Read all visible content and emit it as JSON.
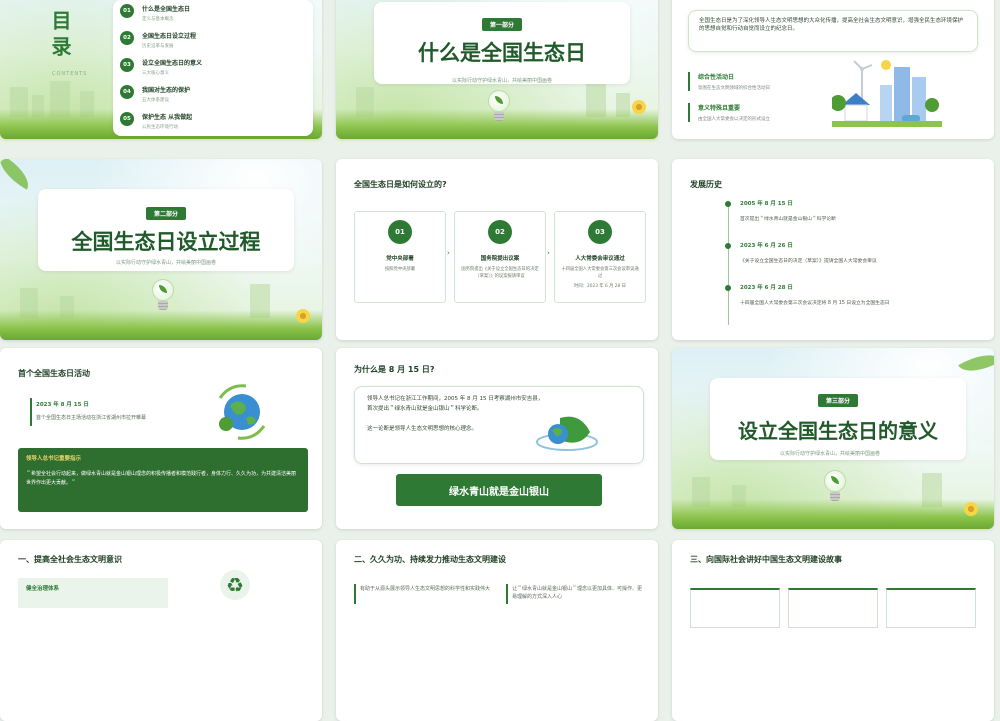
{
  "slides": {
    "toc": {
      "title": "目录",
      "title_en": "CONTENTS",
      "items": [
        {
          "num": "01",
          "title": "什么是全国生态日",
          "sub": "定义与基本概念"
        },
        {
          "num": "02",
          "title": "全国生态日设立过程",
          "sub": "历史沿革与发展"
        },
        {
          "num": "03",
          "title": "设立全国生态日的意义",
          "sub": "三大核心意义"
        },
        {
          "num": "04",
          "title": "我国对生态的保护",
          "sub": "五大体系建设"
        },
        {
          "num": "05",
          "title": "保护生态 从我做起",
          "sub": "公民生态环境行动"
        }
      ]
    },
    "s2": {
      "badge": "第一部分",
      "title": "什么是全国生态日",
      "sub": "以实际行动守护绿水青山，共绘美丽中国画卷"
    },
    "s3": {
      "intro": "全国生态日是为了深化领导人生态文明思想的大众化传播，提高全社会生态文明意识，增强全民生态环境保护的思想自觉和行动自觉而设立的纪念日。",
      "items": [
        {
          "title": "综合性活动日",
          "text": "氛围在生态文明领域的综合性活动日"
        },
        {
          "title": "意义特殊且重要",
          "text": "由全国人大常委会以决定的形式设立"
        }
      ]
    },
    "s4": {
      "badge": "第二部分",
      "title": "全国生态日设立过程",
      "sub": "以实际行动守护绿水青山，共绘美丽中国画卷"
    },
    "s5": {
      "title": "全国生态日是如何设立的?",
      "steps": [
        {
          "num": "01",
          "title": "党中央部署",
          "text": "按照党中央部署"
        },
        {
          "num": "02",
          "title": "国务院提出议案",
          "text": "国务院提出《关于设立全国生态日的决定（草案）》的议案报请审议"
        },
        {
          "num": "03",
          "title": "人大常委会审议通过",
          "text": "十四届全国人大常委会第三次会议审议通过",
          "date": "时间：2023 年 6 月 28 日"
        }
      ]
    },
    "s6": {
      "title": "发展历史",
      "events": [
        {
          "date": "2005 年 8 月 15 日",
          "text": "首次提出＂绿水青山就是金山银山＂科学论断"
        },
        {
          "date": "2023 年 6 月 26 日",
          "text": "《关于设立全国生态日的决定（草案）》提请全国人大常委会审议"
        },
        {
          "date": "2023 年 6 月 28 日",
          "text": "十四届全国人大常委会第三次会议决定将 8 月 15 日设立为全国生态日"
        }
      ]
    },
    "s7": {
      "title": "首个全国生态日活动",
      "date": "2023 年 8 月 15 日",
      "text": "首个全国生态日主场活动在浙江省湖州市拉开帷幕",
      "box_title": "领导人总书记重要指示",
      "box_text": "＂希望全社会行动起来，做绿水青山就是金山银山理念的积极传播者和模范践行者，身体力行、久久为功，为共建清洁美丽世界作出更大贡献。＂"
    },
    "s8": {
      "title": "为什么是 8 月 15 日?",
      "text1": "领导人总书记在浙江工作期间，2005 年 8 月 15 日考察湖州市安吉县，首次提出＂绿水青山就是金山银山＂科学论断。",
      "text2": "这一论断是领导人生态文明思想的核心理念。",
      "banner": "绿水青山就是金山银山"
    },
    "s9": {
      "badge": "第三部分",
      "title": "设立全国生态日的意义",
      "sub": "以实际行动守护绿水青山，共绘美丽中国画卷"
    },
    "s10": {
      "title": "一、提高全社会生态文明意识",
      "item": "健全治理体系"
    },
    "s11": {
      "title": "二、久久为功、持续发力推动生态文明建设",
      "col1": "有助于从源头展示领导人生态文明思想的科学性和实践伟大",
      "col2": "让＂绿水青山就是金山银山＂理念以更加具体、可操作、更易理解的方式深入人心"
    },
    "s12": {
      "title": "三、向国际社会讲好中国生态文明建设故事"
    }
  },
  "colors": {
    "primary": "#2e7a35",
    "dark": "#215a2a",
    "accent": "#f7d548"
  }
}
